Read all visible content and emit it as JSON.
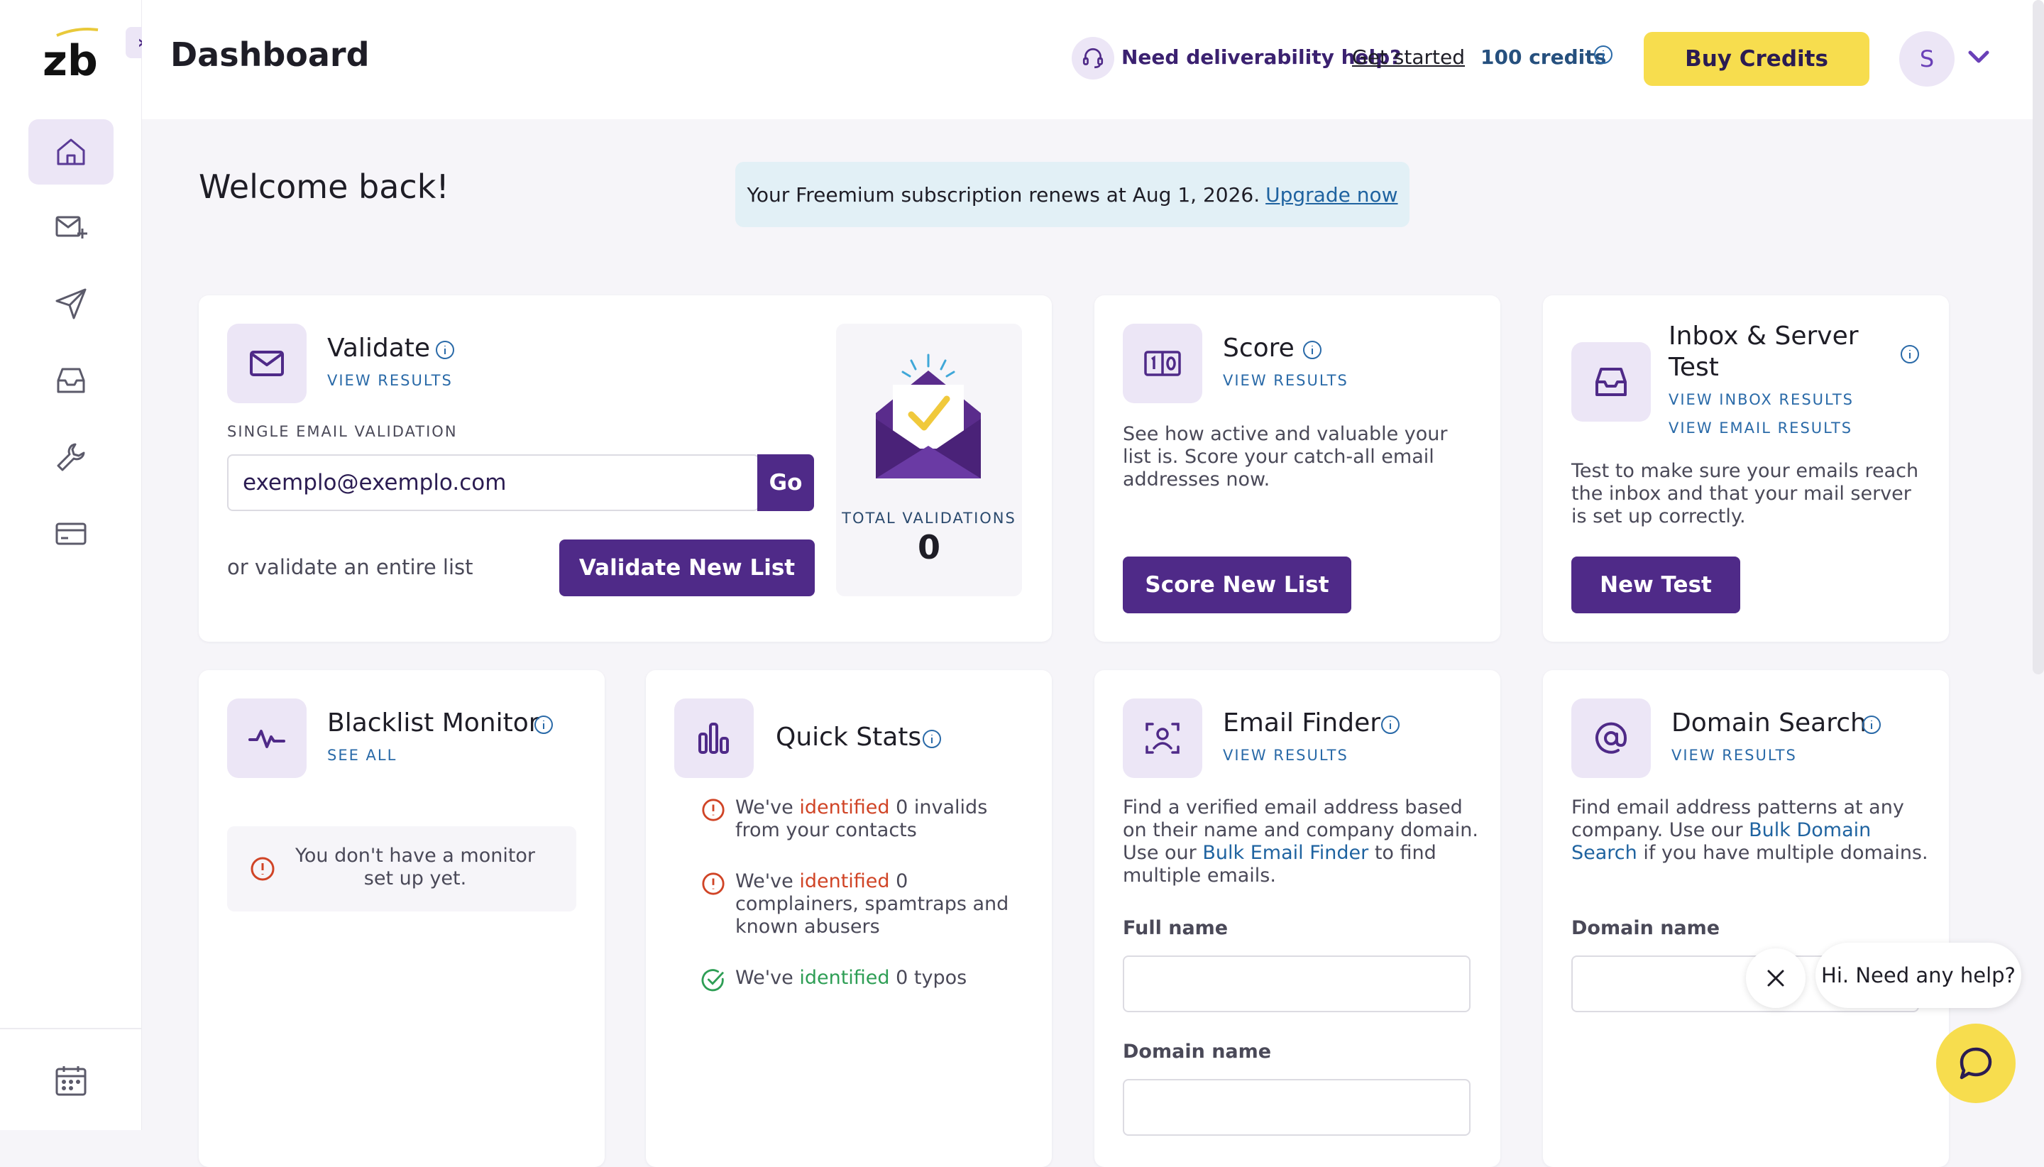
{
  "app": {
    "logo_text": "zb"
  },
  "header": {
    "title": "Dashboard",
    "help_text": "Need deliverability help?",
    "help_link": "Get started",
    "credits": "100 credits",
    "buy_label": "Buy Credits",
    "avatar_initial": "S"
  },
  "welcome": "Welcome back!",
  "notice": {
    "text": "Your Freemium subscription renews at Aug 1, 2026.",
    "link": "Upgrade now"
  },
  "validate": {
    "title": "Validate",
    "link": "VIEW RESULTS",
    "single_label": "SINGLE EMAIL VALIDATION",
    "input_value": "exemplo@exemplo.com",
    "go_label": "Go",
    "or_text": "or validate an entire list",
    "button": "Validate New List",
    "total_label": "TOTAL VALIDATIONS",
    "total_value": "0"
  },
  "score": {
    "title": "Score",
    "link": "VIEW RESULTS",
    "desc": "See how active and valuable your list is. Score your catch-all email addresses now.",
    "button": "Score New List"
  },
  "inbox": {
    "title_line1": "Inbox & Server",
    "title_line2": "Test",
    "link1": "VIEW INBOX RESULTS",
    "link2": "VIEW EMAIL RESULTS",
    "desc": "Test to make sure your emails reach the inbox and that your mail server is set up correctly.",
    "button": "New Test"
  },
  "blacklist": {
    "title": "Blacklist Monitor",
    "link": "SEE ALL",
    "empty_text": "You don't have a monitor set up yet."
  },
  "quickstats": {
    "title": "Quick Stats",
    "rows": [
      {
        "pre": "We've",
        "hl": "identified",
        "post": "0 invalids from your contacts"
      },
      {
        "pre": "We've",
        "hl": "identified",
        "post": "0 complainers, spamtraps and known abusers"
      },
      {
        "pre": "We've",
        "hl": "identified",
        "post": "0 typos"
      }
    ]
  },
  "finder": {
    "title": "Email Finder",
    "link": "VIEW RESULTS",
    "desc_pre": "Find a verified email address based on their name and company domain. Use our",
    "desc_link": "Bulk Email Finder",
    "desc_post": "to find multiple emails.",
    "field1": "Full name",
    "field2": "Domain name"
  },
  "domain": {
    "title": "Domain Search",
    "link": "VIEW RESULTS",
    "desc_pre": "Find email address patterns at any company. Use our",
    "desc_link": "Bulk Domain Search",
    "desc_post": "if you have multiple domains.",
    "field1": "Domain name"
  },
  "chat": {
    "bubble": "Hi. Need any help?"
  },
  "colors": {
    "brand_purple": "#4f2a88",
    "accent_yellow": "#f7dd4e",
    "tile_bg": "#ece6f6"
  }
}
